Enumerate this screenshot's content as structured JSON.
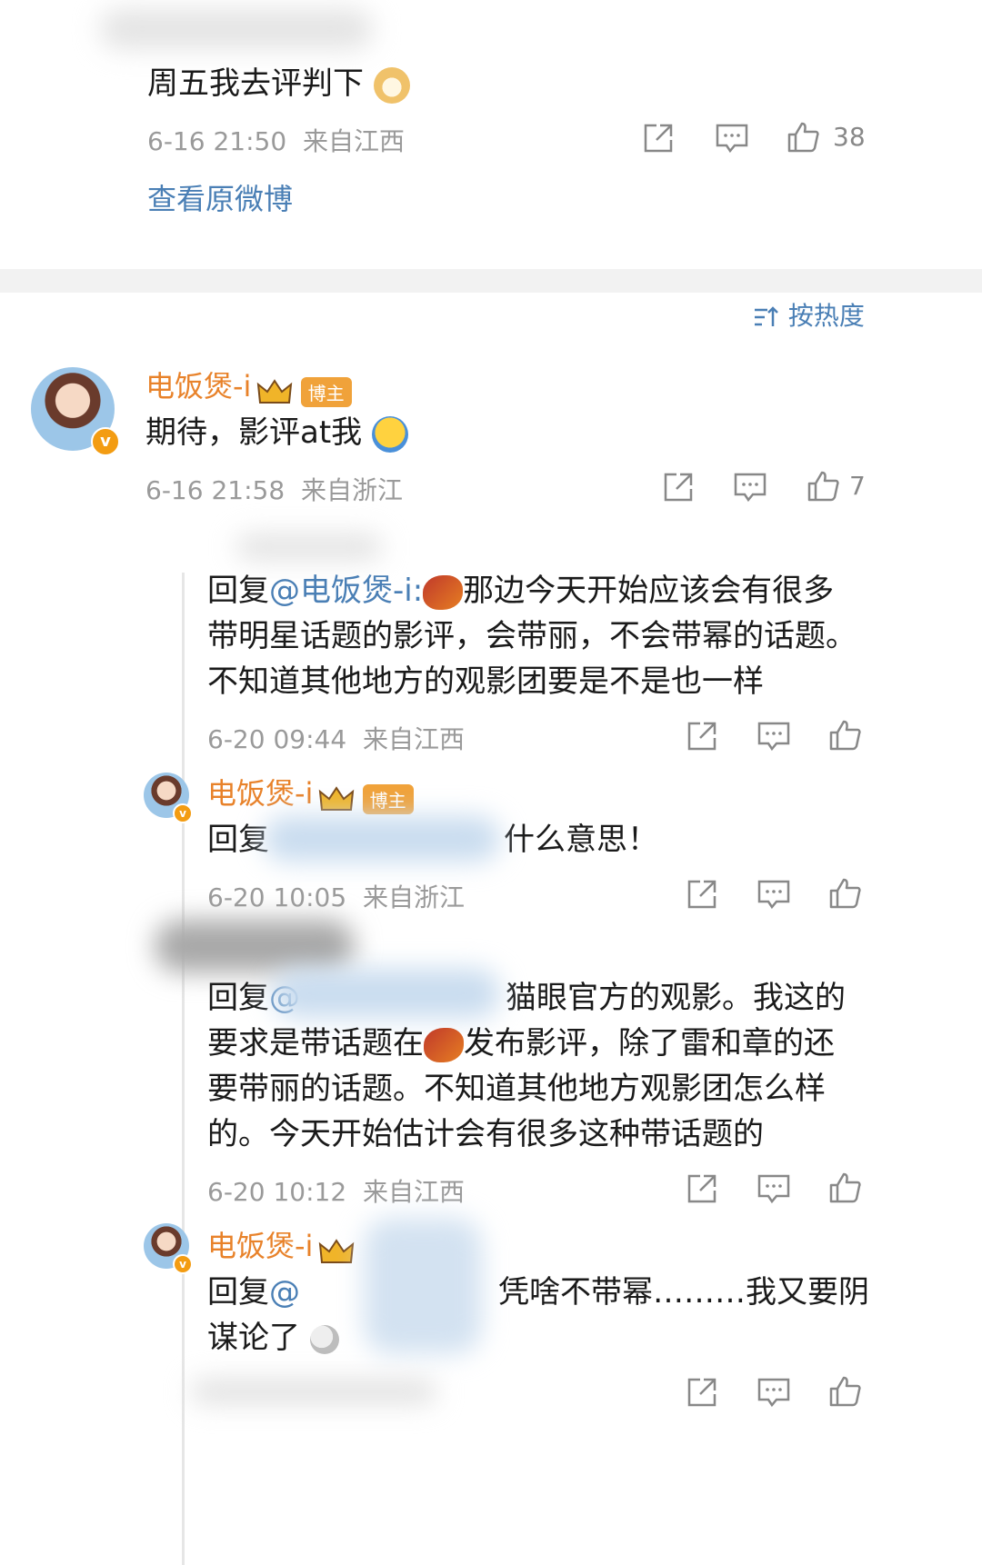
{
  "top_post": {
    "text": "周五我去评判下",
    "time": "6-16 21:50",
    "location": "来自江西",
    "likes": "38",
    "view_original": "查看原微博"
  },
  "sort": {
    "label": "按热度"
  },
  "main_comment": {
    "author": "电饭煲-i",
    "badge": "博主",
    "text": "期待，影评at我",
    "time": "6-16 21:58",
    "location": "来自浙江",
    "likes": "7"
  },
  "replies": [
    {
      "line1_prefix": "回复",
      "line1_at": "@电饭煲-i:",
      "line1_rest": "那边今天开始应该会有很多",
      "line2": "带明星话题的影评，会带丽，不会带幂的话题。",
      "line3": "不知道其他地方的观影团要是不是也一样",
      "time": "6-20 09:44",
      "location": "来自江西"
    },
    {
      "author": "电饭煲-i",
      "badge": "博主",
      "prefix": "回复",
      "rest": "什么意思！",
      "time": "6-20 10:05",
      "location": "来自浙江"
    },
    {
      "prefix": "回复",
      "at": "@",
      "line1_rest": "猫眼官方的观影。我这的",
      "line2_a": "要求是带话题在",
      "line2_b": "发布影评，除了雷和章的还",
      "line3": "要带丽的话题。不知道其他地方观影团怎么样",
      "line4": "的。今天开始估计会有很多这种带话题的",
      "time": "6-20 10:12",
      "location": "来自江西"
    },
    {
      "author": "电饭煲-i",
      "prefix": "回复",
      "at": "@",
      "line1_rest": "凭啥不带幂………我又要阴",
      "line2": "谋论了"
    }
  ]
}
